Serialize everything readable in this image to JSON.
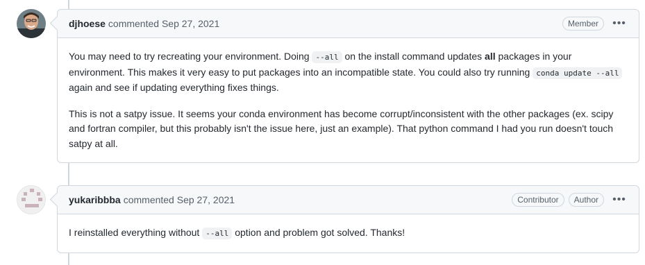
{
  "comments": [
    {
      "author": "djhoese",
      "action": "commented",
      "date": "Sep 27, 2021",
      "badges": [
        "Member"
      ],
      "p1": {
        "t1": "You may need to try recreating your environment. Doing ",
        "c1": "--all",
        "t2": " on the install command updates ",
        "b1": "all",
        "t3": " packages in your environment. This makes it very easy to put packages into an incompatible state. You could also try running ",
        "c2": "conda update --all",
        "t4": " again and see if updating everything fixes things."
      },
      "p2": "This is not a satpy issue. It seems your conda environment has become corrupt/inconsistent with the other packages (ex. scipy and fortran compiler, but this probably isn't the issue here, just an example). That python command I had you run doesn't touch satpy at all."
    },
    {
      "author": "yukaribbba",
      "action": "commented",
      "date": "Sep 27, 2021",
      "badges": [
        "Contributor",
        "Author"
      ],
      "p1": {
        "t1": "I reinstalled everything without ",
        "c1": "--all",
        "t2": " option and problem got solved. Thanks!"
      }
    }
  ],
  "icons": {
    "more": "kebab-horizontal-icon"
  },
  "colors": {
    "border": "#d0d7de",
    "header_bg": "#f6f8fa",
    "identicon": "#c9b2b8"
  }
}
